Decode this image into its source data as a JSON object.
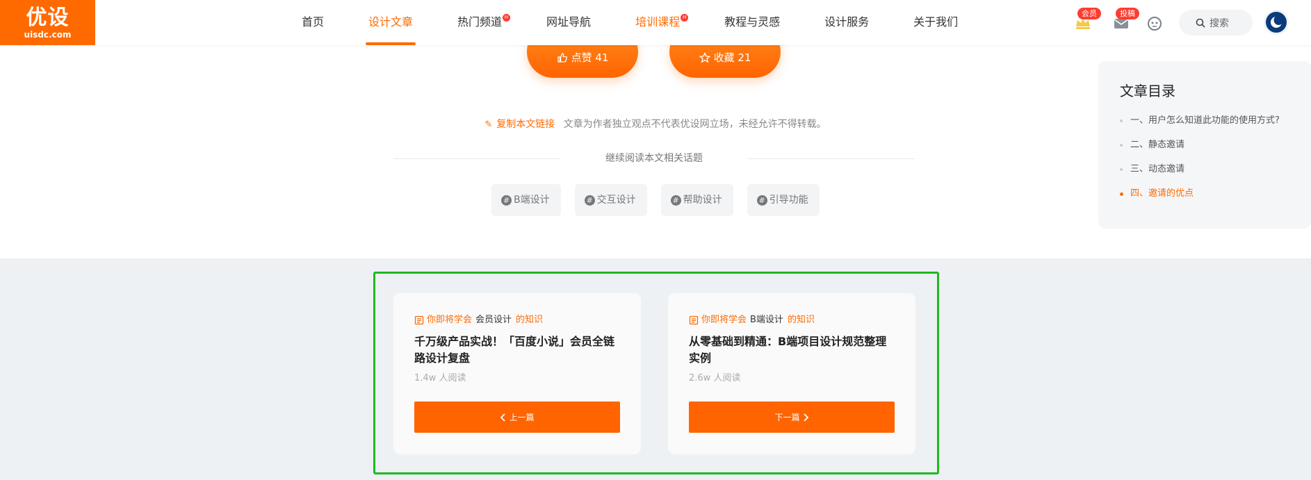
{
  "logo": {
    "main": "优设",
    "sub": "uisdc.com"
  },
  "nav": {
    "items": [
      {
        "label": "首页",
        "hot": false,
        "active": false,
        "orange": false
      },
      {
        "label": "设计文章",
        "hot": false,
        "active": true,
        "orange": true
      },
      {
        "label": "热门频道",
        "hot": true,
        "active": false,
        "orange": false
      },
      {
        "label": "网址导航",
        "hot": false,
        "active": false,
        "orange": false
      },
      {
        "label": "培训课程",
        "hot": true,
        "active": false,
        "orange": true
      },
      {
        "label": "教程与灵感",
        "hot": false,
        "active": false,
        "orange": false
      },
      {
        "label": "设计服务",
        "hot": false,
        "active": false,
        "orange": false
      },
      {
        "label": "关于我们",
        "hot": false,
        "active": false,
        "orange": false
      }
    ],
    "hot_badge": "H"
  },
  "header": {
    "member_badge": "会员",
    "submit_badge": "投稿",
    "search_placeholder": "搜索"
  },
  "actions": {
    "like_label": "点赞 41",
    "collect_label": "收藏 21"
  },
  "copy": {
    "link_label": "复制本文链接",
    "disclaimer": "文章为作者独立观点不代表优设网立场，未经允许不得转载。"
  },
  "related": {
    "heading": "继续阅读本文相关话题",
    "tags": [
      "B端设计",
      "交互设计",
      "帮助设计",
      "引导功能"
    ]
  },
  "toc": {
    "title": "文章目录",
    "items": [
      {
        "label": "一、用户怎么知道此功能的使用方式?",
        "active": false
      },
      {
        "label": "二、静态邀请",
        "active": false
      },
      {
        "label": "三、动态邀请",
        "active": false
      },
      {
        "label": "四、邀请的优点",
        "active": true
      }
    ]
  },
  "cards": [
    {
      "prefix": "你即将学会",
      "topic": "会员设计",
      "suffix": "的知识",
      "title": "千万级产品实战！「百度小说」会员全链路设计复盘",
      "reads": "1.4w 人阅读",
      "button": "上一篇"
    },
    {
      "prefix": "你即将学会",
      "topic": "B端设计",
      "suffix": "的知识",
      "title": "从零基础到精通：B端项目设计规范整理实例",
      "reads": "2.6w 人阅读",
      "button": "下一篇"
    }
  ],
  "colors": {
    "brand": "#ff6a00",
    "highlight": "#1fb81f",
    "bottom_bg": "#eef1f4"
  }
}
